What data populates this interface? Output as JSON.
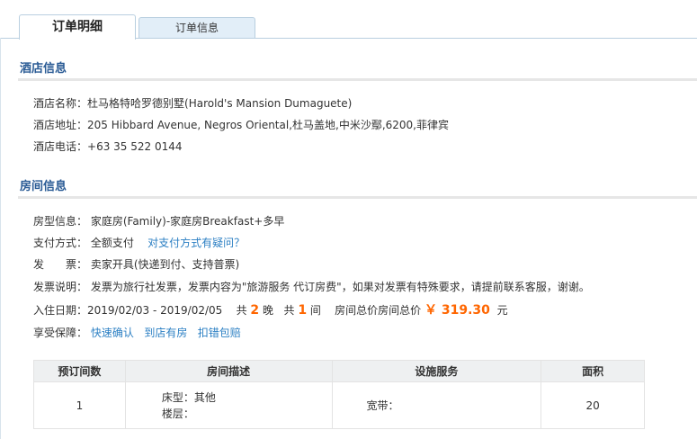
{
  "tabs": [
    {
      "label": "订单明细",
      "active": true
    },
    {
      "label": "订单信息",
      "active": false
    }
  ],
  "hotel_section": {
    "title": "酒店信息",
    "name_label": "酒店名称：",
    "name_value": "杜马格特哈罗德别墅(Harold's Mansion Dumaguete)",
    "address_label": "酒店地址：",
    "address_value": "205 Hibbard Avenue, Negros Oriental,杜马盖地,中米沙鄢,6200,菲律宾",
    "phone_label": "酒店电话：",
    "phone_value": "+63 35 522 0144"
  },
  "room_section": {
    "title": "房间信息",
    "type_label": "房型信息：",
    "type_value": "家庭房(Family)-家庭房Breakfast+多早",
    "payment_label": "支付方式：",
    "payment_value": "全额支付",
    "payment_link": "对支付方式有疑问？",
    "invoice_label": "发　　票：",
    "invoice_value": "卖家开具(快递到付、支持普票)",
    "invoice_note_label": "发票说明：",
    "invoice_note_value": "发票为旅行社发票，发票内容为\"旅游服务 代订房费\"，如果对发票有特殊要求，请提前联系客服，谢谢。",
    "date_label": "入住日期：",
    "date_value": "2019/02/03  - 2019/02/05",
    "nights_prefix": "共",
    "nights": "2",
    "nights_unit": "晚",
    "rooms_prefix": "共",
    "rooms": "1",
    "rooms_unit": "间",
    "total_label": "房间总价房间总价",
    "total_price": "￥ 319.30",
    "total_unit": "元",
    "guarantee_label": "享受保障：",
    "guarantee_links": [
      "快速确认",
      "到店有房",
      "扣错包赔"
    ]
  },
  "table": {
    "headers": [
      "预订间数",
      "房间描述",
      "设施服务",
      "面积"
    ],
    "rows": [
      {
        "count": "1",
        "bed": "床型：其他",
        "floor": "楼层：",
        "facility": "宽带：",
        "area": "20"
      }
    ]
  }
}
